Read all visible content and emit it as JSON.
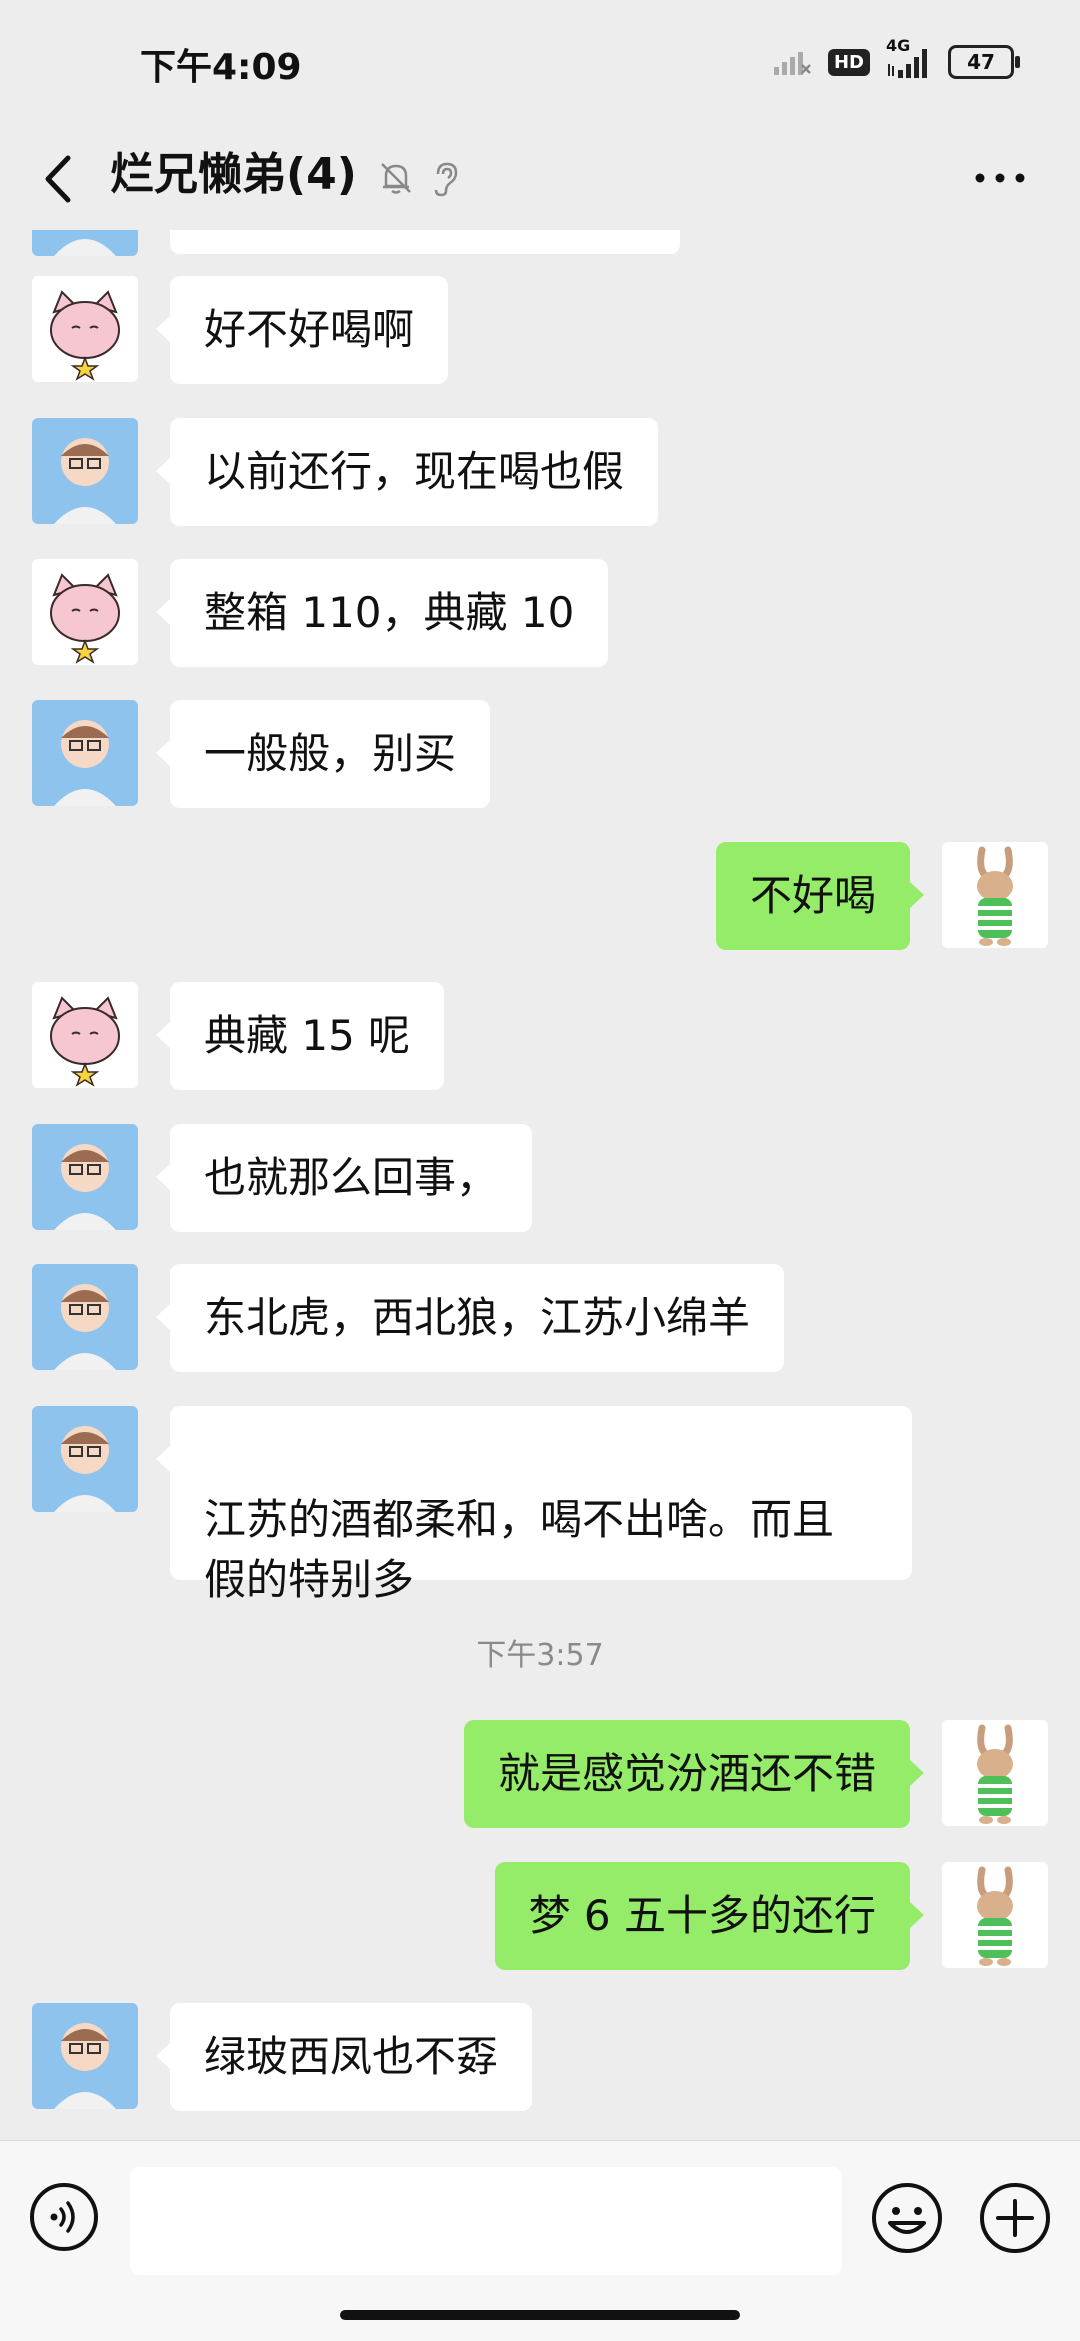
{
  "status": {
    "time": "下午4:09",
    "hd": "HD",
    "network": "4G",
    "battery": "47"
  },
  "header": {
    "title": "烂兄懒弟(4)"
  },
  "messages": [
    {
      "sender": "man",
      "text": ""
    },
    {
      "sender": "cat",
      "text": "好不好喝啊"
    },
    {
      "sender": "man",
      "text": "以前还行，现在喝也假"
    },
    {
      "sender": "cat",
      "text": "整箱 110，典藏 10"
    },
    {
      "sender": "man",
      "text": "一般般，别买"
    },
    {
      "sender": "me",
      "text": "不好喝"
    },
    {
      "sender": "cat",
      "text": "典藏 15 呢"
    },
    {
      "sender": "man",
      "text": "也就那么回事，"
    },
    {
      "sender": "man",
      "text": "东北虎，西北狼，江苏小绵羊"
    },
    {
      "sender": "man",
      "text": "江苏的酒都柔和，喝不出啥。而且\n假的特别多"
    },
    {
      "sender": "me",
      "text": "就是感觉汾酒还不错"
    },
    {
      "sender": "me",
      "text": "梦 6 五十多的还行"
    },
    {
      "sender": "man",
      "text": "绿玻西凤也不孬"
    }
  ],
  "timestamp": "下午3:57",
  "colors": {
    "background": "#ededed",
    "my_bubble": "#95ec69",
    "their_bubble": "#ffffff"
  },
  "icons": [
    "back-arrow",
    "bell-off",
    "ear",
    "more-dots",
    "voice",
    "emoji",
    "plus"
  ]
}
